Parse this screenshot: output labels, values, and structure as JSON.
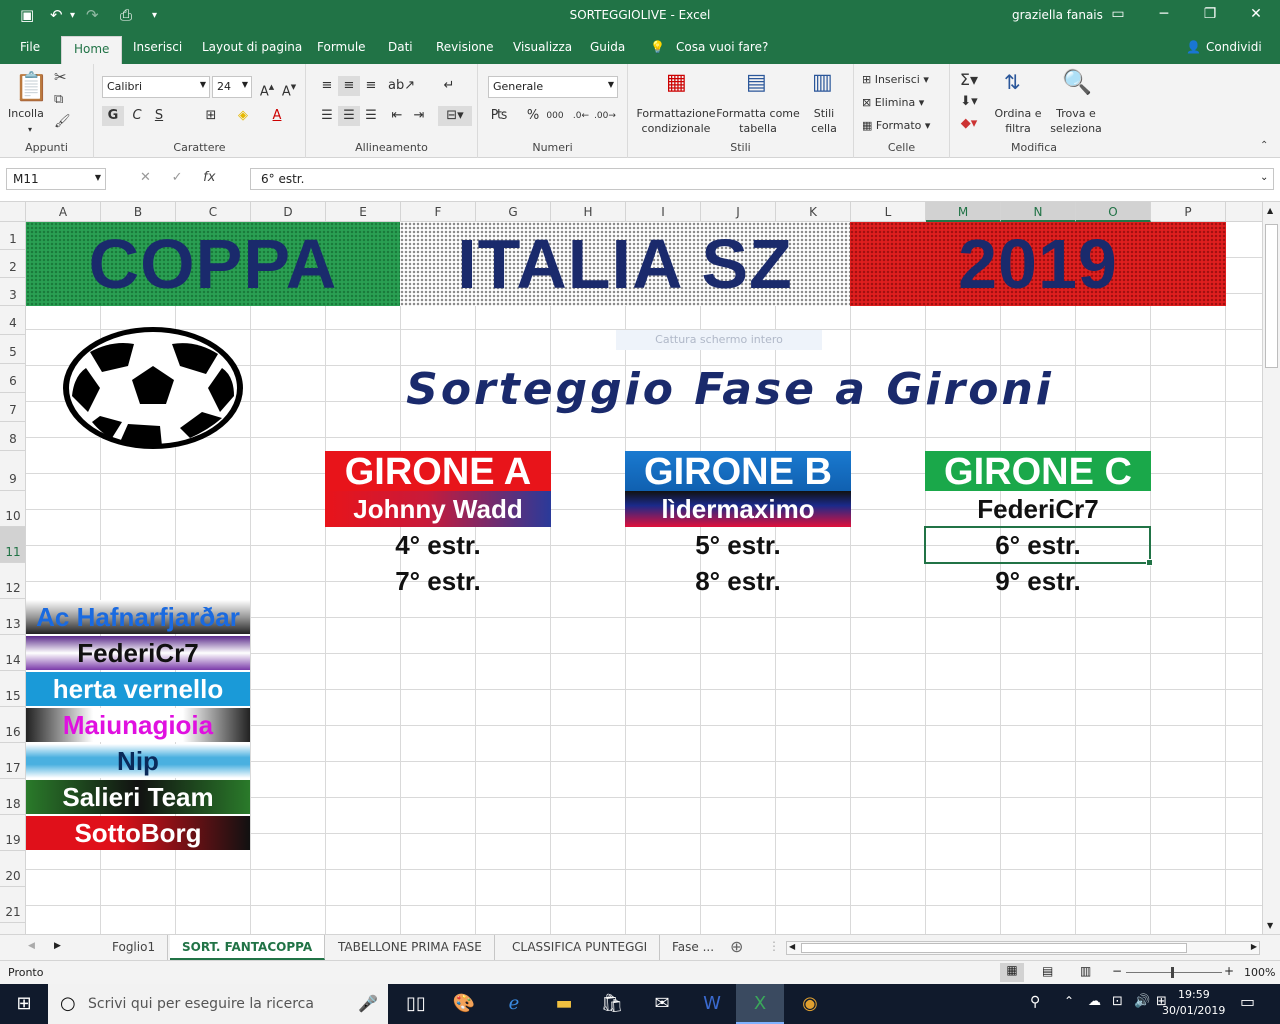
{
  "window": {
    "title": "SORTEGGIOLIVE  -  Excel",
    "user": "graziella fanais"
  },
  "quick_access": {
    "undo_glyph": "↶",
    "redo_glyph": "↷",
    "save_glyph": "🖫"
  },
  "ribbon_tabs": [
    {
      "label": "File"
    },
    {
      "label": "Home"
    },
    {
      "label": "Inserisci"
    },
    {
      "label": "Layout di pagina"
    },
    {
      "label": "Formule"
    },
    {
      "label": "Dati"
    },
    {
      "label": "Revisione"
    },
    {
      "label": "Visualizza"
    },
    {
      "label": "Guida"
    }
  ],
  "tell_me": "Cosa vuoi fare?",
  "share": "Condividi",
  "ribbon": {
    "paste": "Incolla",
    "font_name": "Calibri",
    "font_size": "24",
    "bold": "G",
    "italic": "C",
    "underline": "S",
    "number_format": "Generale",
    "cond_format": "Formattazione condizionale",
    "format_table": "Formatta come tabella",
    "cell_styles": "Stili cella",
    "insert": "Inserisci",
    "delete": "Elimina",
    "format": "Formato",
    "sort": "Ordina e filtra",
    "find": "Trova e seleziona",
    "groups": [
      "Appunti",
      "Carattere",
      "Allineamento",
      "Numeri",
      "Stili",
      "Celle",
      "Modifica"
    ]
  },
  "formula_bar": {
    "name_box": "M11",
    "formula": "6° estr.",
    "fx": "fx"
  },
  "columns": [
    "A",
    "B",
    "C",
    "D",
    "E",
    "F",
    "G",
    "H",
    "I",
    "J",
    "K",
    "L",
    "M",
    "N",
    "O",
    "P"
  ],
  "rows": [
    "1",
    "2",
    "3",
    "4",
    "5",
    "6",
    "7",
    "8",
    "9",
    "10",
    "11",
    "12",
    "13",
    "14",
    "15",
    "16",
    "17",
    "18",
    "19",
    "20",
    "21"
  ],
  "sheet": {
    "banner": [
      "COPPA",
      "ITALIA SZ",
      "2019"
    ],
    "subtitle": "Sorteggio Fase a Gironi",
    "ghost_text": "Cattura schermo intero",
    "groups": [
      {
        "name": "GIRONE A",
        "team": "Johnny Wadd",
        "slots": [
          "4° estr.",
          "7° estr."
        ]
      },
      {
        "name": "GIRONE B",
        "team": "lìdermaximo",
        "slots": [
          "5° estr.",
          "8° estr."
        ]
      },
      {
        "name": "GIRONE C",
        "team": "FederiCr7",
        "slots": [
          "6° estr.",
          "9° estr."
        ]
      }
    ],
    "teams": [
      "Ac Hafnarfjarðar",
      "FederiCr7",
      "herta vernello",
      "Maiunagioia",
      "Nip",
      "Salieri Team",
      "SottoBorg"
    ]
  },
  "sheet_tabs": [
    {
      "label": "Foglio1"
    },
    {
      "label": "SORT. FANTACOPPA"
    },
    {
      "label": "TABELLONE PRIMA FASE"
    },
    {
      "label": "CLASSIFICA PUNTEGGI"
    },
    {
      "label": "Fase ..."
    }
  ],
  "status": {
    "ready": "Pronto",
    "zoom": "100%"
  },
  "taskbar": {
    "search": "Scrivi qui per eseguire la ricerca",
    "time": "19:59",
    "date": "30/01/2019"
  }
}
